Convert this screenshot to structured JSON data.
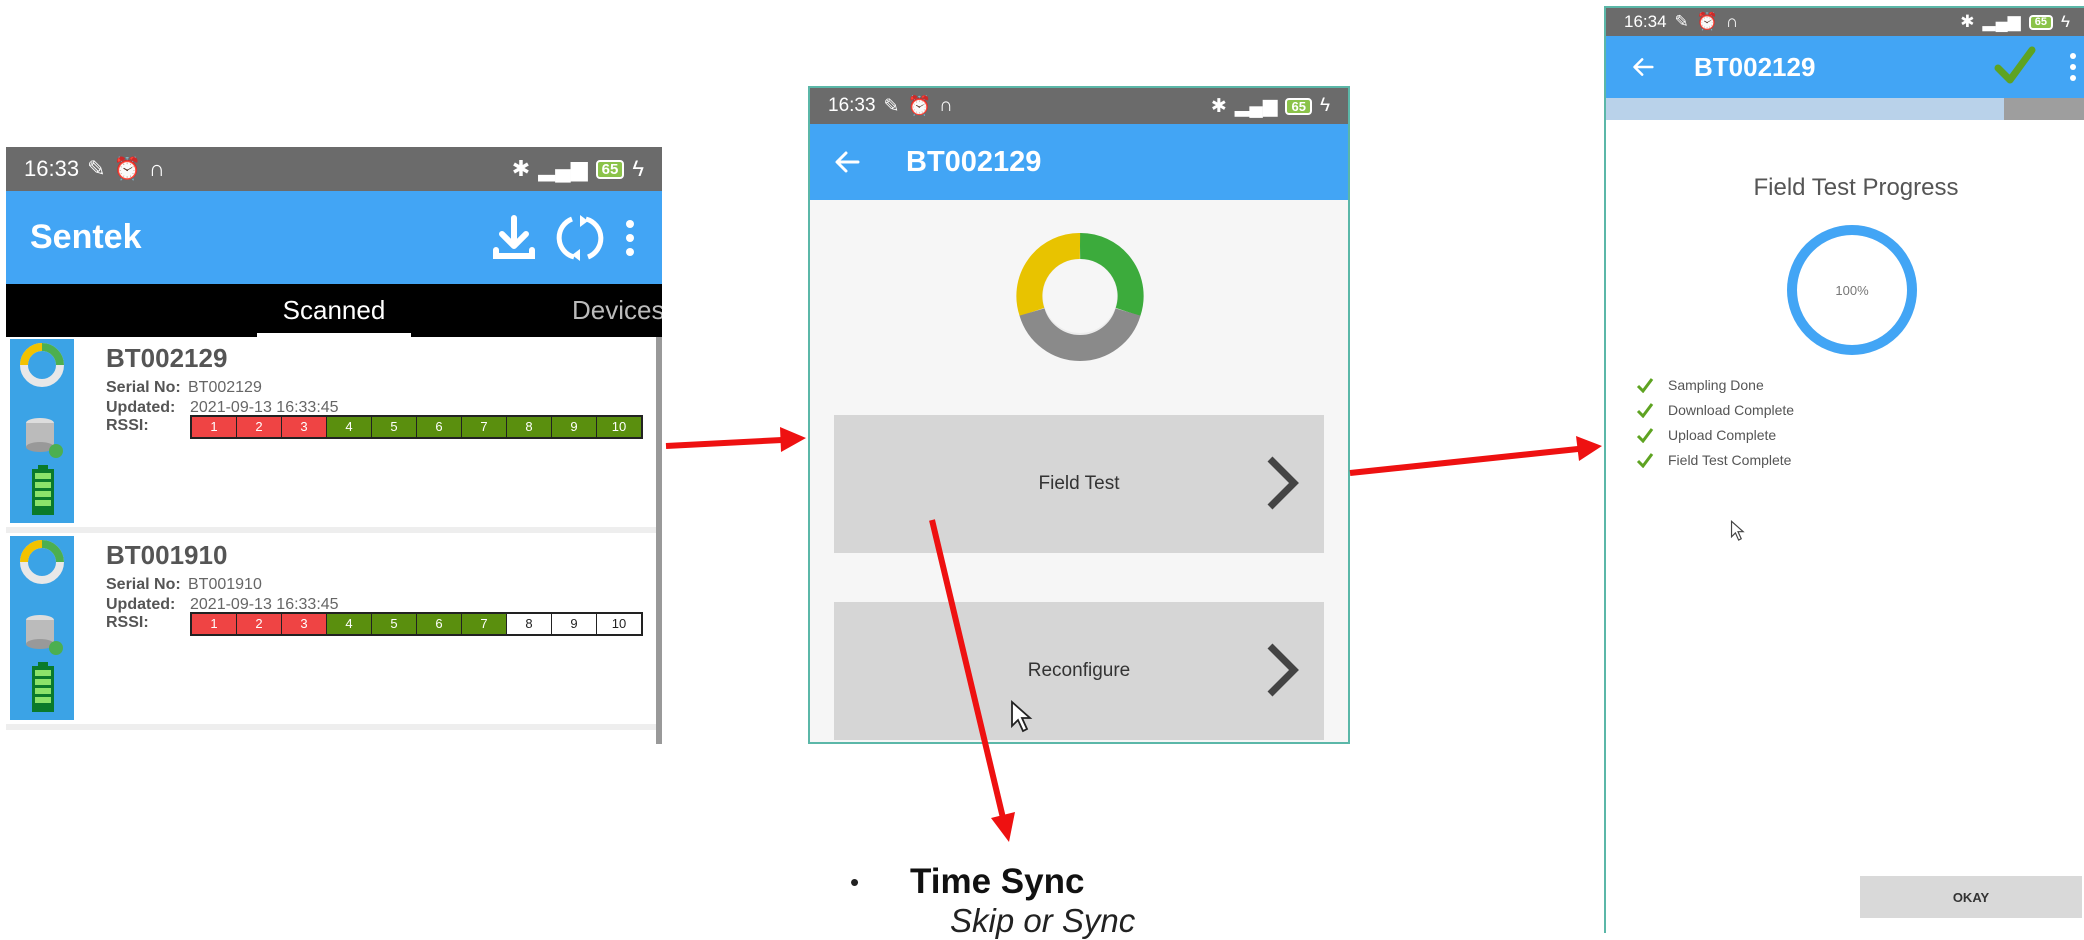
{
  "screen1": {
    "status_time": "16:33",
    "battery": "65",
    "app_title": "Sentek",
    "tabs": [
      "Scanned",
      "Devices"
    ],
    "labels": {
      "serial": "Serial No:",
      "updated": "Updated:",
      "rssi": "RSSI:"
    },
    "devices": [
      {
        "name": "BT002129",
        "serial": "BT002129",
        "updated": "2021-09-13 16:33:45",
        "rssi": [
          "1",
          "2",
          "3",
          "4",
          "5",
          "6",
          "7",
          "8",
          "9",
          "10"
        ],
        "rssi_strength": 10,
        "rssi_red": 3
      },
      {
        "name": "BT001910",
        "serial": "BT001910",
        "updated": "2021-09-13 16:33:45",
        "rssi": [
          "1",
          "2",
          "3",
          "4",
          "5",
          "6",
          "7",
          "8",
          "9",
          "10"
        ],
        "rssi_strength": 7,
        "rssi_red": 3
      }
    ],
    "colors": {
      "appbar": "#42a5f5",
      "rssi_red": "#ef4444",
      "rssi_green": "#5a8f0e"
    }
  },
  "screen2": {
    "status_time": "16:33",
    "battery": "65",
    "title": "BT002129",
    "buttons": [
      "Field Test",
      "Reconfigure"
    ]
  },
  "screen3": {
    "status_time": "16:34",
    "battery": "65",
    "title": "BT002129",
    "heading": "Field Test Progress",
    "progress_label": "100%",
    "progress": 1.0,
    "steps": [
      "Sampling Done",
      "Download Complete",
      "Upload Complete",
      "Field Test Complete"
    ],
    "okay_label": "OKAY"
  },
  "annotation": {
    "title": "Time Sync",
    "subtitle": "Skip or Sync"
  },
  "icons": [
    "back-arrow-icon",
    "download-icon",
    "refresh-icon",
    "more-vert-icon",
    "checkmark-icon",
    "chevron-right-icon",
    "cursor-icon"
  ]
}
